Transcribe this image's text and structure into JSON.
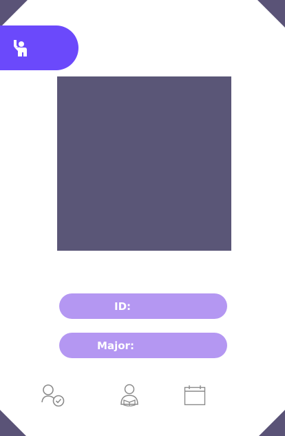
{
  "header": {
    "raise_hand_icon": "raise-hand-icon",
    "accent_color": "#6b49fb"
  },
  "profile": {
    "photo_placeholder_color": "#5a5677",
    "id_label": "ID:",
    "major_label": "Major:",
    "pill_color": "#b497f2"
  },
  "bottom_nav": {
    "items": [
      {
        "icon": "user-check-icon"
      },
      {
        "icon": "user-reading-icon"
      },
      {
        "icon": "calendar-icon"
      }
    ],
    "icon_color": "#8a8a8a"
  },
  "decor": {
    "corner_color": "#5a5377"
  }
}
